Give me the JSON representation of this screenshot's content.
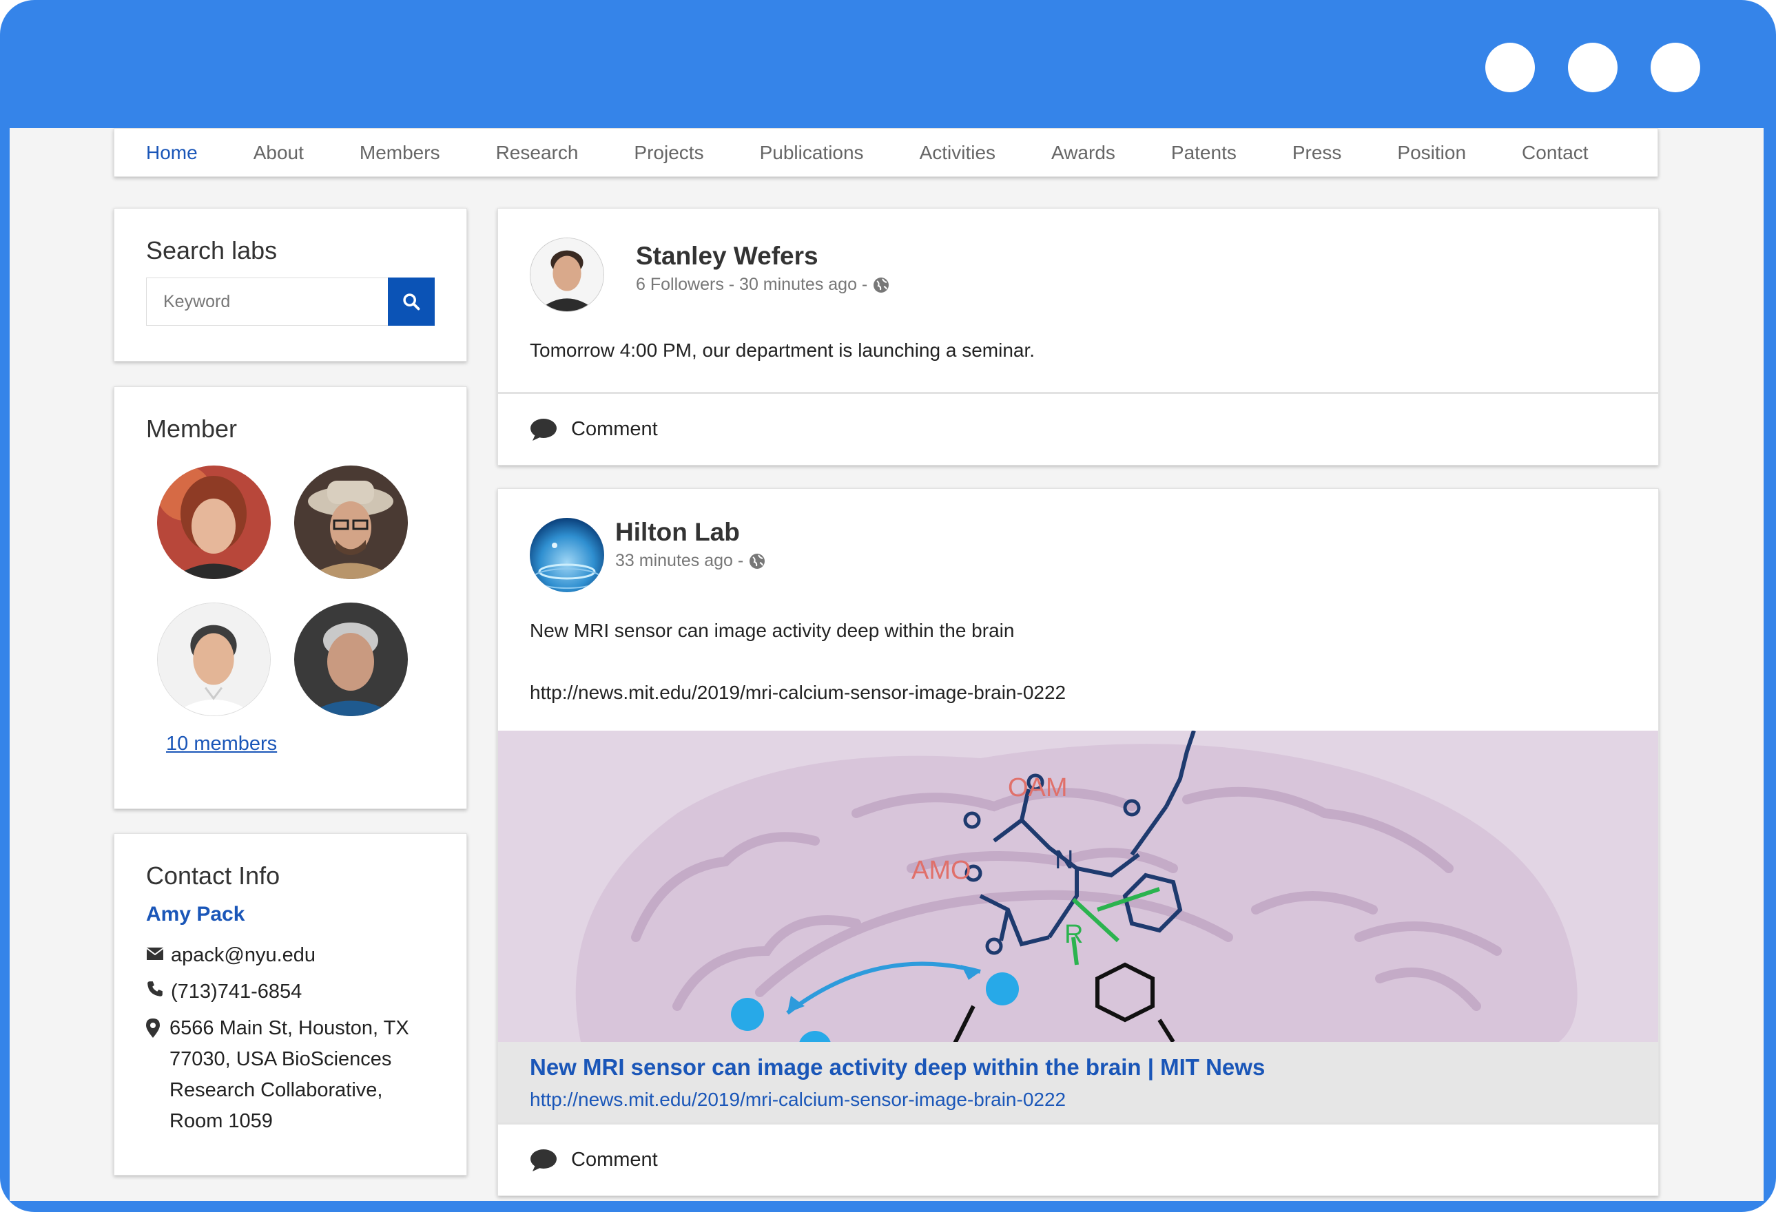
{
  "nav": {
    "items": [
      {
        "label": "Home",
        "active": true
      },
      {
        "label": "About"
      },
      {
        "label": "Members"
      },
      {
        "label": "Research"
      },
      {
        "label": "Projects"
      },
      {
        "label": "Publications"
      },
      {
        "label": "Activities"
      },
      {
        "label": "Awards"
      },
      {
        "label": "Patents"
      },
      {
        "label": "Press"
      },
      {
        "label": "Position"
      },
      {
        "label": "Contact"
      }
    ]
  },
  "search": {
    "title": "Search labs",
    "placeholder": "Keyword"
  },
  "members": {
    "title": "Member",
    "link_label": "10 members"
  },
  "contact": {
    "title": "Contact Info",
    "name": "Amy Pack",
    "email": "apack@nyu.edu",
    "phone": "(713)741-6854",
    "address": "6566 Main St, Houston, TX 77030, USA BioSciences Research Collaborative, Room 1059"
  },
  "posts": [
    {
      "author": "Stanley Wefers",
      "meta": "6 Followers - 30 minutes ago -",
      "text": "Tomorrow 4:00 PM, our department is launching a seminar.",
      "comment_label": "Comment"
    },
    {
      "author": "Hilton Lab",
      "meta": "33 minutes ago -",
      "text": "New MRI sensor can image activity deep within the brain",
      "url": "http://news.mit.edu/2019/mri-calcium-sensor-image-brain-0222",
      "preview": {
        "title": "New MRI sensor can image activity deep within the brain | MIT News",
        "url": "http://news.mit.edu/2019/mri-calcium-sensor-image-brain-0222",
        "labels": {
          "oam": "OAM",
          "amo": "AMO",
          "n": "N",
          "r": "R"
        }
      },
      "comment_label": "Comment"
    }
  ],
  "colors": {
    "frame": "#3584e9",
    "accent": "#1a56b8",
    "button": "#0b53b6"
  }
}
